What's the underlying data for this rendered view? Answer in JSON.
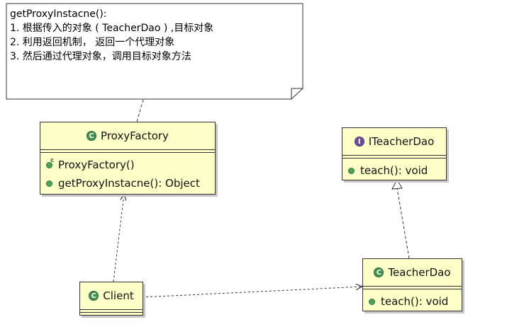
{
  "note": {
    "lines": [
      "getProxyInstacne():",
      "1. 根据传入的对象 ( TeacherDao ) ,目标对象",
      "2. 利用返回机制， 返回一个代理对象",
      "3. 然后通过代理对象，调用目标对象方法"
    ]
  },
  "classes": {
    "proxy_factory": {
      "name": "ProxyFactory",
      "kind": "class",
      "operations": [
        "ProxyFactory()",
        "getProxyInstacne(): Object"
      ]
    },
    "iteacher_dao": {
      "name": "ITeacherDao",
      "kind": "interface",
      "operations": [
        "teach(): void"
      ]
    },
    "teacher_dao": {
      "name": "TeacherDao",
      "kind": "class",
      "operations": [
        "teach(): void"
      ]
    },
    "client": {
      "name": "Client",
      "kind": "class",
      "operations": []
    }
  },
  "icons": {
    "class": "class-icon",
    "interface": "interface-icon",
    "method": "public-method-icon",
    "constructor": "constructor-icon"
  },
  "colors": {
    "class_fill": "#ffffc8",
    "class_icon": "#3f8f4f",
    "interface_icon": "#6b4aa3"
  }
}
